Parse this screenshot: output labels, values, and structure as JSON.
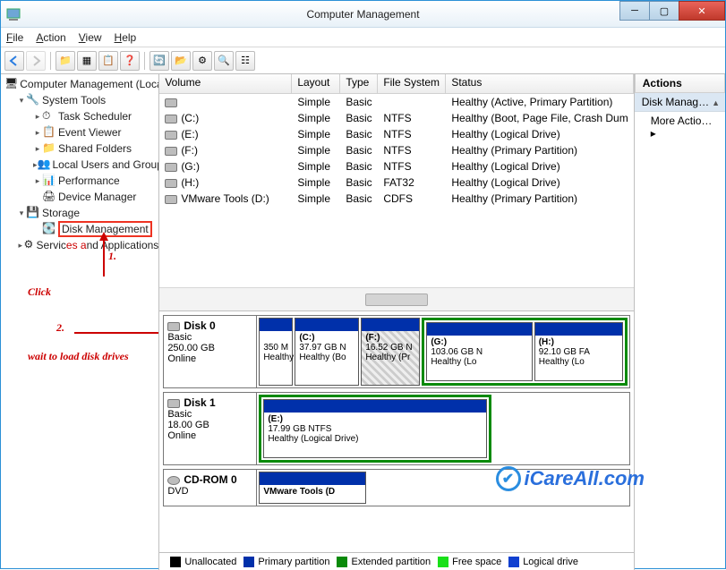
{
  "window": {
    "title": "Computer Management"
  },
  "menu": [
    "File",
    "Action",
    "View",
    "Help"
  ],
  "tree": {
    "root": "Computer Management (Local",
    "system_tools": "System Tools",
    "system_children": [
      "Task Scheduler",
      "Event Viewer",
      "Shared Folders",
      "Local Users and Groups",
      "Performance",
      "Device Manager"
    ],
    "storage": "Storage",
    "disk_mgmt": "Disk Management",
    "services": "Services and Applications"
  },
  "annot": {
    "click": "Click",
    "step1": "1.",
    "step2": "2.",
    "wait": "wait to load disk drives"
  },
  "columns": [
    "Volume",
    "Layout",
    "Type",
    "File System",
    "Status"
  ],
  "volumes": [
    {
      "v": "",
      "l": "Simple",
      "t": "Basic",
      "fs": "",
      "s": "Healthy (Active, Primary Partition)"
    },
    {
      "v": "(C:)",
      "l": "Simple",
      "t": "Basic",
      "fs": "NTFS",
      "s": "Healthy (Boot, Page File, Crash Dum"
    },
    {
      "v": "(E:)",
      "l": "Simple",
      "t": "Basic",
      "fs": "NTFS",
      "s": "Healthy (Logical Drive)"
    },
    {
      "v": "(F:)",
      "l": "Simple",
      "t": "Basic",
      "fs": "NTFS",
      "s": "Healthy (Primary Partition)"
    },
    {
      "v": "(G:)",
      "l": "Simple",
      "t": "Basic",
      "fs": "NTFS",
      "s": "Healthy (Logical Drive)"
    },
    {
      "v": "(H:)",
      "l": "Simple",
      "t": "Basic",
      "fs": "FAT32",
      "s": "Healthy (Logical Drive)"
    },
    {
      "v": "VMware Tools (D:)",
      "l": "Simple",
      "t": "Basic",
      "fs": "CDFS",
      "s": "Healthy (Primary Partition)"
    }
  ],
  "disks": {
    "d0": {
      "name": "Disk 0",
      "type": "Basic",
      "size": "250.00 GB",
      "state": "Online"
    },
    "d1": {
      "name": "Disk 1",
      "type": "Basic",
      "size": "18.00 GB",
      "state": "Online"
    },
    "cd": {
      "name": "CD-ROM 0",
      "type": "DVD"
    }
  },
  "parts": {
    "p350": {
      "size": "350 M",
      "stat": "Healthy"
    },
    "c": {
      "label": "(C:)",
      "size": "37.97 GB N",
      "stat": "Healthy (Bo"
    },
    "f": {
      "label": "(F:)",
      "size": "16.52 GB N",
      "stat": "Healthy (Pr"
    },
    "g": {
      "label": "(G:)",
      "size": "103.06 GB N",
      "stat": "Healthy (Lo"
    },
    "h": {
      "label": "(H:)",
      "size": "92.10 GB FA",
      "stat": "Healthy (Lo"
    },
    "e": {
      "label": "(E:)",
      "size": "17.99 GB NTFS",
      "stat": "Healthy (Logical Drive)"
    },
    "vm": {
      "label": "VMware Tools  (D"
    }
  },
  "legend": {
    "unalloc": "Unallocated",
    "primary": "Primary partition",
    "ext": "Extended partition",
    "free": "Free space",
    "logical": "Logical drive"
  },
  "actions": {
    "header": "Actions",
    "group": "Disk Manag…",
    "more": "More Actio…"
  },
  "watermark": "iCareAll.com"
}
